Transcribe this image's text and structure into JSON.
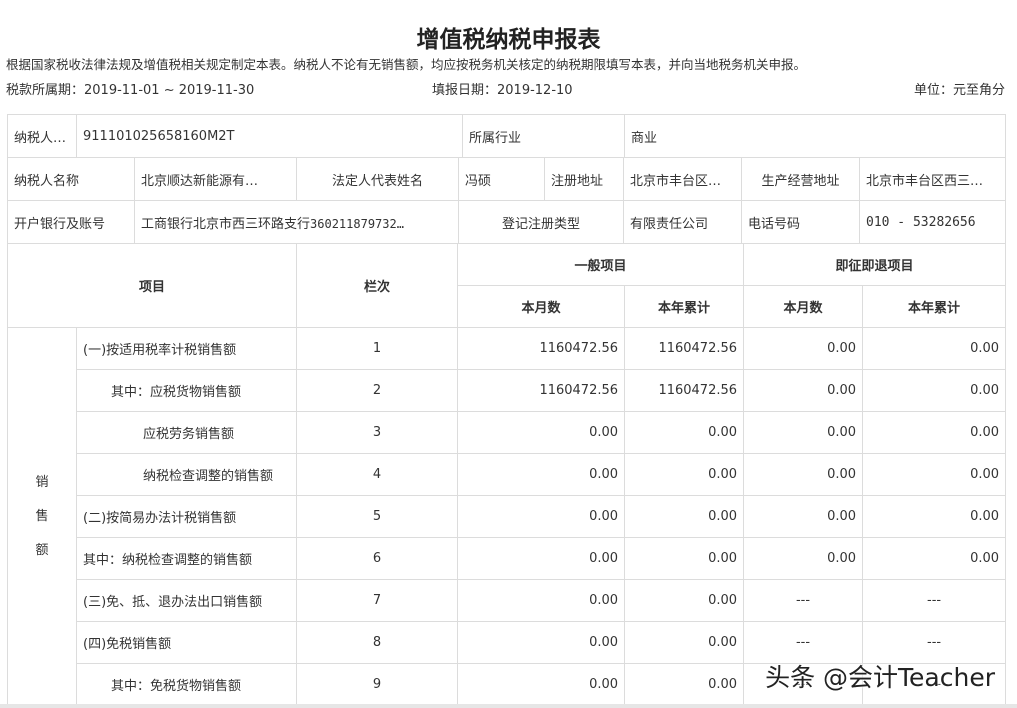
{
  "title": "增值税纳税申报表",
  "notice": "根据国家税收法律法规及增值税相关规定制定本表。纳税人不论有无销售额，均应按税务机关核定的纳税期限填写本表，并向当地税务机关申报。",
  "period_label": "税款所属期：",
  "period_value": "2019-11-01 ~ 2019-11-30",
  "fill_date_label": "填报日期：",
  "fill_date_value": "2019-12-10",
  "unit": "单位：元至角分",
  "taxpayer": {
    "id_label": "纳税人识别号",
    "id_value": "911101025658160M2T",
    "industry_label": "所属行业",
    "industry_value": "商业",
    "name_label": "纳税人名称",
    "name_value": "北京顺达新能源有…",
    "legal_rep_label": "法定人代表姓名",
    "legal_rep_value": "冯硕",
    "reg_addr_label": "注册地址",
    "reg_addr_value": "北京市丰台区…",
    "biz_addr_label": "生产经营地址",
    "biz_addr_value": "北京市丰台区西三…",
    "bank_label": "开户银行及账号",
    "bank_value": "工商银行北京市西三环路支行",
    "bank_account": "360211879732…",
    "reg_type_label": "登记注册类型",
    "reg_type_value": "有限责任公司",
    "phone_label": "电话号码",
    "phone_value": "010 - 53282656"
  },
  "headers": {
    "item": "项目",
    "line": "栏次",
    "general": "一般项目",
    "immediate": "即征即退项目",
    "month": "本月数",
    "ytd": "本年累计"
  },
  "section_label": [
    "销",
    "售",
    "额"
  ],
  "rows": [
    {
      "item": "(一)按适用税率计税销售额",
      "line": "1",
      "gm": "1160472.56",
      "gy": "1160472.56",
      "im": "0.00",
      "iy": "0.00"
    },
    {
      "item": "其中：应税货物销售额",
      "line": "2",
      "gm": "1160472.56",
      "gy": "1160472.56",
      "im": "0.00",
      "iy": "0.00"
    },
    {
      "item": "应税劳务销售额",
      "line": "3",
      "gm": "0.00",
      "gy": "0.00",
      "im": "0.00",
      "iy": "0.00"
    },
    {
      "item": "纳税检查调整的销售额",
      "line": "4",
      "gm": "0.00",
      "gy": "0.00",
      "im": "0.00",
      "iy": "0.00"
    },
    {
      "item": "(二)按简易办法计税销售额",
      "line": "5",
      "gm": "0.00",
      "gy": "0.00",
      "im": "0.00",
      "iy": "0.00"
    },
    {
      "item": "其中：纳税检查调整的销售额",
      "line": "6",
      "gm": "0.00",
      "gy": "0.00",
      "im": "0.00",
      "iy": "0.00"
    },
    {
      "item": "(三)免、抵、退办法出口销售额",
      "line": "7",
      "gm": "0.00",
      "gy": "0.00",
      "im": "---",
      "iy": "---"
    },
    {
      "item": "(四)免税销售额",
      "line": "8",
      "gm": "0.00",
      "gy": "0.00",
      "im": "---",
      "iy": "---"
    },
    {
      "item": "其中：免税货物销售额",
      "line": "9",
      "gm": "0.00",
      "gy": "0.00",
      "im": "---",
      "iy": "---"
    }
  ],
  "watermark": "头条 @会计Teacher"
}
